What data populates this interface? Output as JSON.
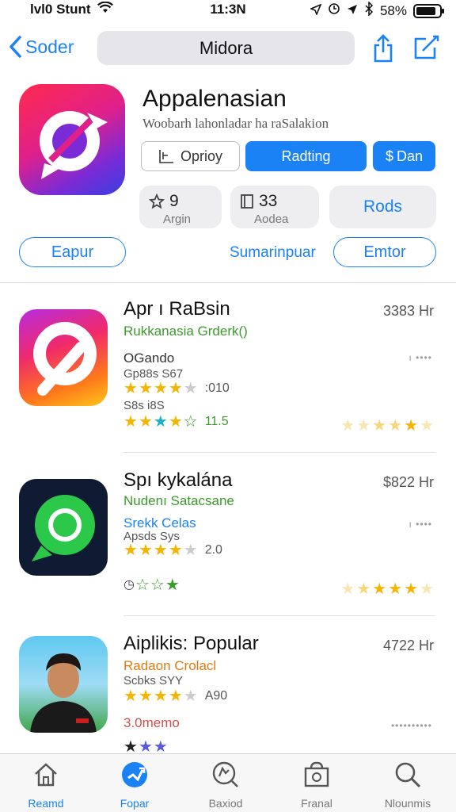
{
  "status": {
    "carrier": "lvl0 Stunt",
    "time": "11:3Ν",
    "battery_pct": "58%"
  },
  "nav": {
    "back_label": "Soder",
    "title": "Midora"
  },
  "hero": {
    "title": "Appalenasian",
    "subtitle": "Woobarh lahonladar ha raSalakion",
    "btn_outline": "Oprioy",
    "btn_primary": "Radting",
    "btn_small": "Dan",
    "stat1_value": "9",
    "stat1_label": "Argin",
    "stat2_value": "33",
    "stat2_label": "Aodea",
    "stat3_label": "Rods",
    "pill_left": "Eapur",
    "center_link": "Sumarinpuar",
    "pill_right": "Emtor"
  },
  "items": [
    {
      "name": "Apr ı RaBsin",
      "price": "3383 Hr",
      "developer": "Rukkanasia Grderk()",
      "line1": "OGando",
      "line2": "Gp88s S67",
      "rating1_text": ":010",
      "line3": "S8s i8S",
      "rating2_text": "11.5"
    },
    {
      "name": "Spı kykalána",
      "price": "$822 Hr",
      "developer": "Nudenı Satacsane",
      "line1": "Srekk Celas",
      "line2": "Apsds Sys",
      "rating1_text": "2.0"
    },
    {
      "name": "Aiplikis: Popular",
      "price": "4722 Hr",
      "developer": "Radaon Crolacl",
      "line2": "Scbks SYY",
      "rating1_text": "A90",
      "line3": "3.0memo"
    }
  ],
  "tabs": [
    "Reamd",
    "Fopar",
    "Baxiod",
    "Franal",
    "Nlounmis"
  ],
  "colors": {
    "accent": "#1a82f5",
    "star": "#f5b400",
    "green": "#3b9a2a"
  }
}
